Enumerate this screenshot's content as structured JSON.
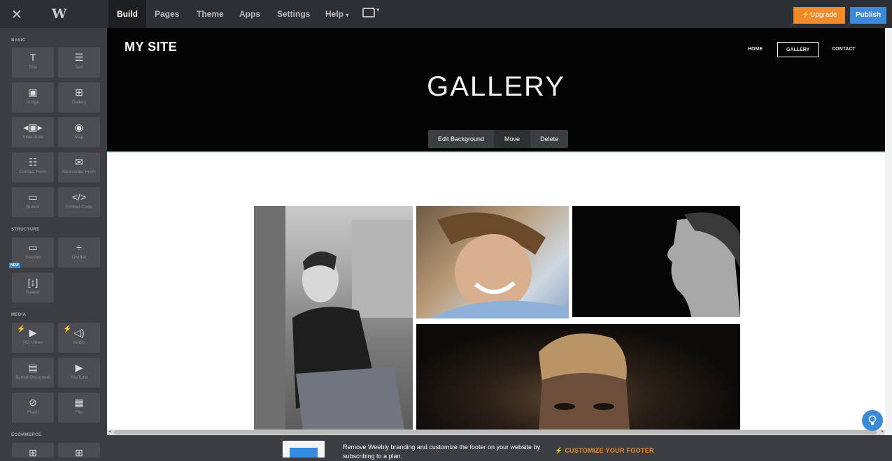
{
  "topbar": {
    "close_icon": "✕",
    "logo": "W",
    "tabs": [
      "Build",
      "Pages",
      "Theme",
      "Apps",
      "Settings",
      "Help"
    ],
    "help_caret": "▾",
    "upgrade_label": "Upgrade",
    "upgrade_icon": "⚡",
    "publish_label": "Publish"
  },
  "sidebar": {
    "sections": {
      "basic": "BASIC",
      "structure": "STRUCTURE",
      "media": "MEDIA",
      "ecommerce": "ECOMMERCE"
    },
    "new_badge": "NEW",
    "tiles": [
      {
        "label": "Title",
        "icon": "T"
      },
      {
        "label": "Text",
        "icon": "☰"
      },
      {
        "label": "Image",
        "icon": "▣"
      },
      {
        "label": "Gallery",
        "icon": "⊞"
      },
      {
        "label": "Slideshow",
        "icon": "◂▣▸"
      },
      {
        "label": "Map",
        "icon": "◉"
      },
      {
        "label": "Contact Form",
        "icon": "☷"
      },
      {
        "label": "Newsletter Form",
        "icon": "✉"
      },
      {
        "label": "Button",
        "icon": "▭"
      },
      {
        "label": "Embed Code",
        "icon": "</>"
      },
      {
        "label": "Section",
        "icon": "▭"
      },
      {
        "label": "Divider",
        "icon": "÷"
      },
      {
        "label": "Spacer",
        "icon": "[↕]"
      },
      {
        "label": "HD Video",
        "icon": "▶"
      },
      {
        "label": "Audio",
        "icon": "◁)"
      },
      {
        "label": "Scribd Document",
        "icon": "▤"
      },
      {
        "label": "YouTube",
        "icon": "▶"
      },
      {
        "label": "Flash",
        "icon": "⊘"
      },
      {
        "label": "File",
        "icon": "▦"
      },
      {
        "label": "",
        "icon": "⊞"
      },
      {
        "label": "",
        "icon": "⊞"
      }
    ]
  },
  "site": {
    "name": "MY SITE",
    "nav": [
      "HOME",
      "GALLERY",
      "CONTACT"
    ],
    "headline": "GALLERY"
  },
  "block_toolbar": {
    "edit_background": "Edit Background",
    "move": "Move",
    "delete": "Delete"
  },
  "footer": {
    "message": "Remove Weebly branding and customize the footer on your website by subscribing to a plan.",
    "cta": "CUSTOMIZE YOUR FOOTER",
    "cta_icon": "⚡"
  },
  "help_icon": "lightbulb-icon",
  "colors": {
    "accent_orange": "#f2892b",
    "accent_blue": "#3b8ad9",
    "sidebar_bg": "#3a3d41",
    "topbar_bg": "#2c2f33"
  }
}
